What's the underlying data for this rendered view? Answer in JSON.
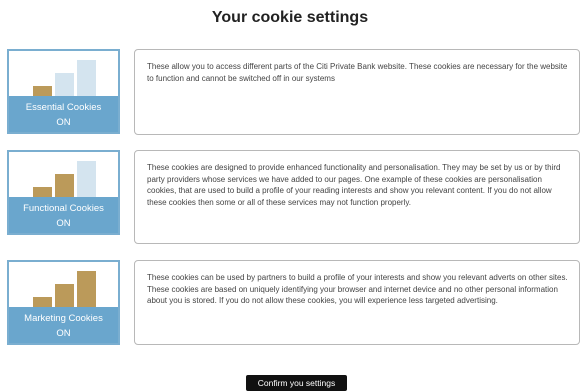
{
  "page": {
    "title": "Your cookie settings"
  },
  "colors": {
    "tile_border": "#7aaed0",
    "tile_band": "#6aa6cd",
    "bar_on": "#bb9a5a",
    "bar_off": "#d4e4ef",
    "confirm_bg": "#111111"
  },
  "categories": [
    {
      "name": "Essential Cookies",
      "state": "ON",
      "bars_active": 1,
      "description": "These allow you to access different parts of the Citi Private Bank website. These cookies are necessary for the website to function and cannot be switched off in our systems"
    },
    {
      "name": "Functional Cookies",
      "state": "ON",
      "bars_active": 2,
      "description": "These cookies are designed to provide enhanced functionality and personalisation. They may be set by us or by third party providers whose services we have added to our pages. One example of these cookies are personalisation cookies, that are used to build a profile of your reading interests and show you relevant content. If you do not allow these cookies then some or all of these services may not function properly."
    },
    {
      "name": "Marketing Cookies",
      "state": "ON",
      "bars_active": 3,
      "description": "These cookies can be used by partners to build a profile of your interests and show you relevant adverts on other sites. These cookies are based on uniquely identifying your browser and internet device and no other personal information about you is stored. If you do not allow these cookies, you will experience less targeted advertising."
    }
  ],
  "actions": {
    "confirm_label": "Confirm you settings"
  }
}
